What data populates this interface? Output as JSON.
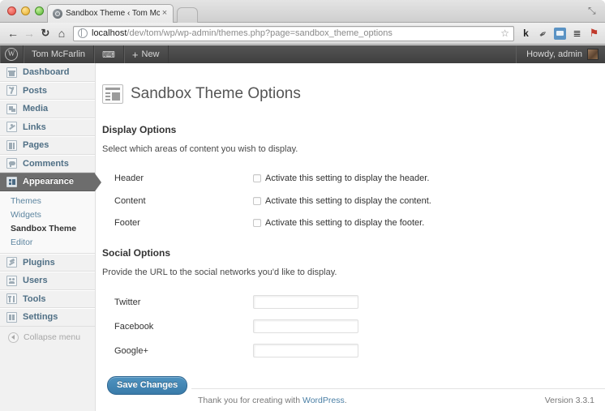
{
  "browser": {
    "tab": {
      "title": "Sandbox Theme ‹ Tom McFa",
      "close_label": "×",
      "favicon_name": "wordpress-favicon"
    },
    "new_tab_label": "",
    "window_expand_label": "⤡",
    "nav": {
      "back_label": "←",
      "forward_label": "→",
      "reload_label": "↻",
      "home_label": "⌂"
    },
    "address": {
      "host": "localhost",
      "path": "/dev/tom/wp/wp-admin/themes.php?page=sandbox_theme_options",
      "star_label": "☆"
    },
    "extensions": [
      {
        "name": "klout-extension",
        "label": "k"
      },
      {
        "name": "eyedropper-extension",
        "label": "✒"
      },
      {
        "name": "screenshot-extension",
        "label": ""
      },
      {
        "name": "stack-extension",
        "label": "≣"
      },
      {
        "name": "pin-extension",
        "label": "⚑"
      }
    ]
  },
  "adminbar": {
    "logo_label": "W",
    "site_name": "Tom McFarlin",
    "comments_label": "⌨",
    "new_plus": "+",
    "new_label": "New",
    "howdy": "Howdy, admin"
  },
  "sidebar": {
    "items": [
      {
        "label": "Dashboard",
        "icon": "dashboard-icon",
        "icon_class": "ic-dash"
      },
      {
        "label": "Posts",
        "icon": "posts-icon",
        "icon_class": "ic-posts"
      },
      {
        "label": "Media",
        "icon": "media-icon",
        "icon_class": "ic-media"
      },
      {
        "label": "Links",
        "icon": "links-icon",
        "icon_class": "ic-links"
      },
      {
        "label": "Pages",
        "icon": "pages-icon",
        "icon_class": "ic-pages"
      },
      {
        "label": "Comments",
        "icon": "comments-icon",
        "icon_class": "ic-comments"
      },
      {
        "label": "Appearance",
        "icon": "appearance-icon",
        "icon_class": "ic-appear"
      }
    ],
    "submenu": [
      {
        "label": "Themes",
        "active": false
      },
      {
        "label": "Widgets",
        "active": false
      },
      {
        "label": "Sandbox Theme",
        "active": true
      },
      {
        "label": "Editor",
        "active": false
      }
    ],
    "items_lower": [
      {
        "label": "Plugins",
        "icon": "plugins-icon",
        "icon_class": "ic-plugins"
      },
      {
        "label": "Users",
        "icon": "users-icon",
        "icon_class": "ic-users"
      },
      {
        "label": "Tools",
        "icon": "tools-icon",
        "icon_class": "ic-tools"
      },
      {
        "label": "Settings",
        "icon": "settings-icon",
        "icon_class": "ic-settings"
      }
    ],
    "collapse_label": "Collapse menu"
  },
  "main": {
    "page_title": "Sandbox Theme Options",
    "page_icon": "theme-options-icon",
    "display_options": {
      "heading": "Display Options",
      "description": "Select which areas of content you wish to display.",
      "rows": [
        {
          "label": "Header",
          "checkbox_label": "Activate this setting to display the header.",
          "checked": false
        },
        {
          "label": "Content",
          "checkbox_label": "Activate this setting to display the content.",
          "checked": false
        },
        {
          "label": "Footer",
          "checkbox_label": "Activate this setting to display the footer.",
          "checked": false
        }
      ]
    },
    "social_options": {
      "heading": "Social Options",
      "description": "Provide the URL to the social networks you'd like to display.",
      "rows": [
        {
          "label": "Twitter",
          "value": "",
          "placeholder": ""
        },
        {
          "label": "Facebook",
          "value": "",
          "placeholder": ""
        },
        {
          "label": "Google+",
          "value": "",
          "placeholder": ""
        }
      ]
    },
    "save_button": "Save Changes"
  },
  "footer": {
    "thanks_prefix": "Thank you for creating with ",
    "wordpress_link": "WordPress",
    "thanks_suffix": ".",
    "version": "Version 3.3.1"
  }
}
